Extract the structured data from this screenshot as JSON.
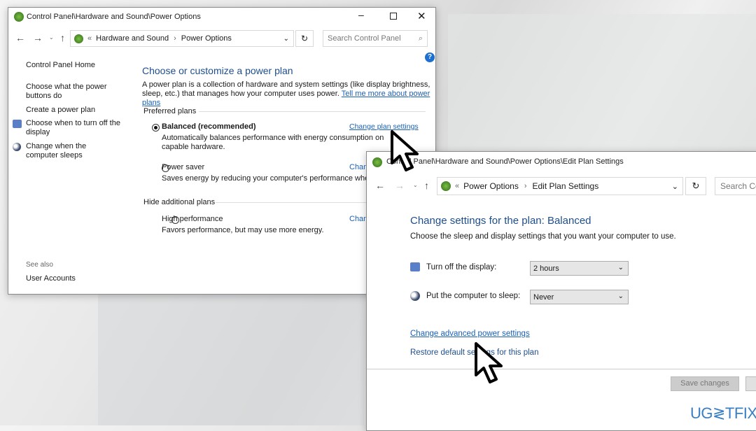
{
  "window1": {
    "title": "Control Panel\\Hardware and Sound\\Power Options",
    "breadcrumb": [
      "Hardware and Sound",
      "Power Options"
    ],
    "search_placeholder": "Search Control Panel",
    "sidebar": {
      "home": "Control Panel Home",
      "items": [
        "Choose what the power buttons do",
        "Create a power plan",
        "Choose when to turn off the display",
        "Change when the computer sleeps"
      ],
      "see_also": "See also",
      "see_also_items": [
        "User Accounts"
      ]
    },
    "main": {
      "heading": "Choose or customize a power plan",
      "desc": "A power plan is a collection of hardware and system settings (like display brightness, sleep, etc.) that manages how your computer uses power.",
      "desc_link": "Tell me more about power plans",
      "preferred_label": "Preferred plans",
      "hide_label": "Hide additional plans",
      "plans": [
        {
          "name": "Balanced (recommended)",
          "desc": "Automatically balances performance with energy consumption on capable hardware.",
          "link": "Change plan settings",
          "selected": true
        },
        {
          "name": "Power saver",
          "desc": "Saves energy by reducing your computer's performance where possible.",
          "link": "Change plan settings",
          "selected": false
        },
        {
          "name": "High performance",
          "desc": "Favors performance, but may use more energy.",
          "link": "Change plan settings",
          "selected": false
        }
      ]
    }
  },
  "window2": {
    "title": "Control Panel\\Hardware and Sound\\Power Options\\Edit Plan Settings",
    "breadcrumb": [
      "Power Options",
      "Edit Plan Settings"
    ],
    "search_placeholder": "Search Control Panel",
    "heading": "Change settings for the plan: Balanced",
    "subheading": "Choose the sleep and display settings that you want your computer to use.",
    "display_label": "Turn off the display:",
    "display_value": "2 hours",
    "sleep_label": "Put the computer to sleep:",
    "sleep_value": "Never",
    "advanced_link": "Change advanced power settings",
    "restore_link": "Restore default settings for this plan",
    "save_button": "Save changes"
  },
  "watermark": "UG≷TFIX",
  "colors": {
    "link": "#1a5fb4",
    "heading": "#1e4e8c",
    "watermark": "#3a7fc1"
  }
}
